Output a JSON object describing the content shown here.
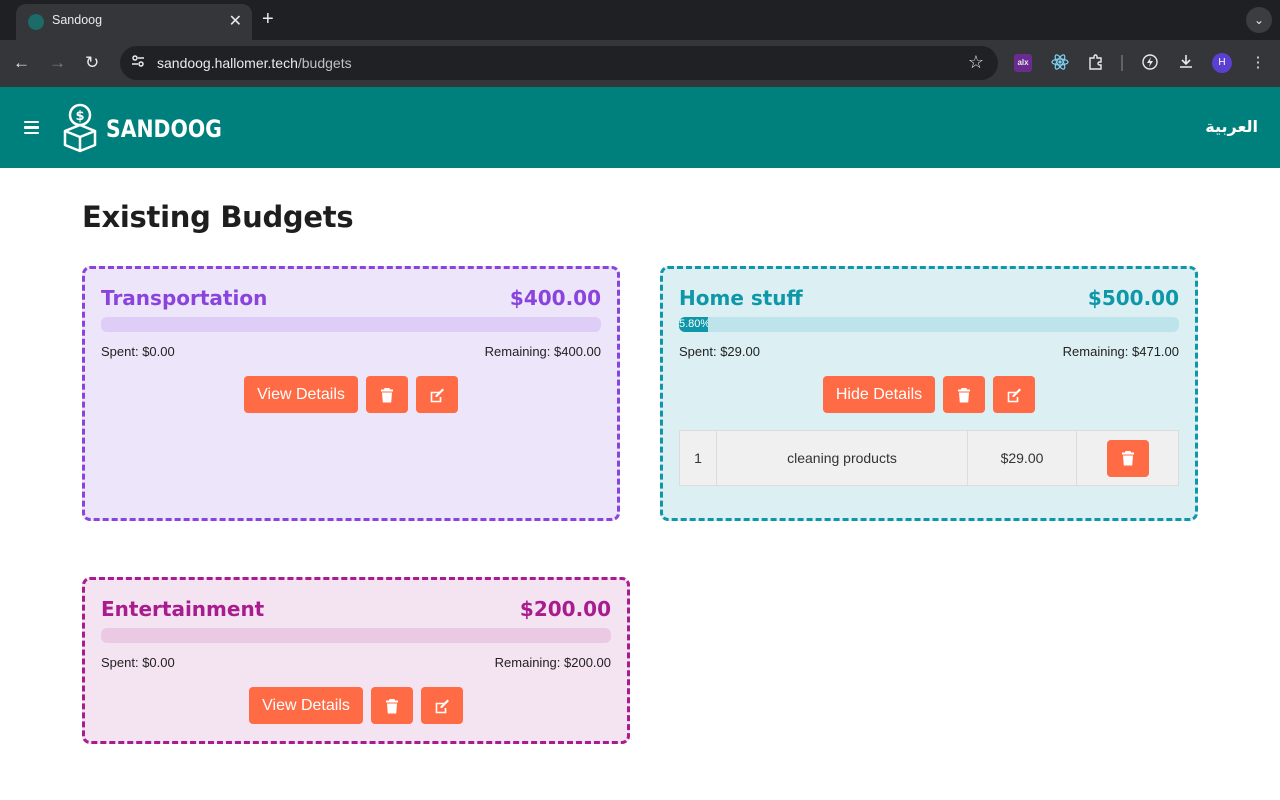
{
  "browser": {
    "tab_title": "Sandoog",
    "url_host": "sandoog.hallomer.tech",
    "url_path": "/budgets",
    "avatar_initial": "H",
    "alx_label": "alx"
  },
  "header": {
    "logo_text": "SANDOOG",
    "language_link": "العربية",
    "background_color": "#00807c"
  },
  "page": {
    "title": "Existing Budgets"
  },
  "budgets": [
    {
      "name": "Transportation",
      "amount": "$400.00",
      "progress_percent": 0,
      "progress_label": "",
      "spent": "Spent: $0.00",
      "remaining": "Remaining: $400.00",
      "details_button": "View Details",
      "color": "#8a44dd"
    },
    {
      "name": "Home stuff",
      "amount": "$500.00",
      "progress_percent": 5.8,
      "progress_label": "5.80%",
      "spent": "Spent: $29.00",
      "remaining": "Remaining: $471.00",
      "details_button": "Hide Details",
      "color": "#0e97a8",
      "expenses": [
        {
          "index": "1",
          "name": "cleaning products",
          "amount": "$29.00"
        }
      ]
    },
    {
      "name": "Entertainment",
      "amount": "$200.00",
      "progress_percent": 0,
      "progress_label": "",
      "spent": "Spent: $0.00",
      "remaining": "Remaining: $200.00",
      "details_button": "View Details",
      "color": "#a81c8e"
    }
  ],
  "accent_button_color": "#ff6b45"
}
